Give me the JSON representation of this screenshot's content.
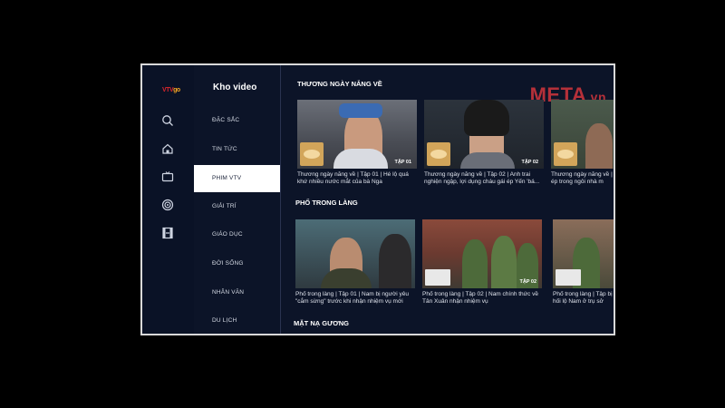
{
  "app": {
    "logo_text": "VTV",
    "logo_sub": "go"
  },
  "rail": {
    "icons": [
      "search-icon",
      "home-icon",
      "tv-icon",
      "target-icon",
      "film-icon"
    ]
  },
  "menu": {
    "title": "Kho video",
    "items": [
      {
        "label": "ĐẶC SẮC"
      },
      {
        "label": "TIN TỨC"
      },
      {
        "label": "PHIM VTv",
        "active": true
      },
      {
        "label": "GIẢI TRÍ"
      },
      {
        "label": "GIÁO DỤC"
      },
      {
        "label": "ĐỜI SỐNG"
      },
      {
        "label": "NHÂN VĂN"
      },
      {
        "label": "DU LỊCH"
      }
    ]
  },
  "watermark": {
    "main": "META",
    "suffix": ".vn"
  },
  "sections": [
    {
      "title": "THƯƠNG NGÀY NẮNG VỀ",
      "cards": [
        {
          "caption": "Thương ngày nắng về | Tập 01 | Hé lộ quá khứ nhiều nước mắt của bà Nga",
          "badge": "TẬP 01"
        },
        {
          "caption": "Thương ngày nắng về | Tập 02 | Anh trai nghiện ngập, lợi dụng cháu gái ép Yến 'bá...",
          "badge": "TẬP 02"
        },
        {
          "caption": "Thương ngày nắng về | ép trong ngôi nhà m",
          "badge": ""
        }
      ]
    },
    {
      "title": "PHỐ TRONG LÀNG",
      "cards": [
        {
          "caption": "Phố trong làng | Tập 01 | Nam bị người yêu \"cắm sừng\" trước khi nhận nhiệm vụ mới",
          "badge": ""
        },
        {
          "caption": "Phố trong làng | Tập 02 | Nam chính thức về Tân Xuân nhận nhiệm vụ",
          "badge": "TẬP 02"
        },
        {
          "caption": "Phố trong làng | Tập bị hối lộ Nam ở trụ sở",
          "badge": ""
        }
      ]
    },
    {
      "title": "MẶT NẠ GƯƠNG"
    }
  ]
}
